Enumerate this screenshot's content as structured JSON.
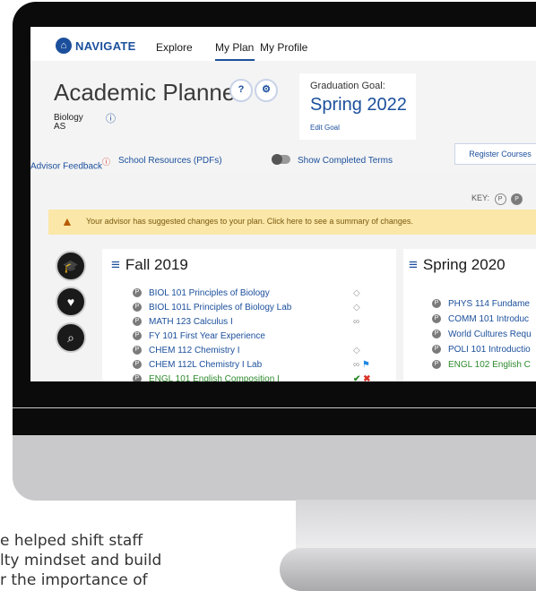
{
  "nav": {
    "logo": "NAVIGATE",
    "items": [
      "Explore",
      "My Plan",
      "My Profile"
    ]
  },
  "header": {
    "title": "Academic Planner",
    "help_icon": "question-icon",
    "settings_icon": "gear-icon",
    "major": "Biology",
    "degree": "AS",
    "graduation_goal_label": "Graduation Goal:",
    "graduation_goal_value": "Spring 2022",
    "edit_goal": "Edit Goal"
  },
  "links": {
    "advisor_feedback": "Advisor Feedback",
    "school_resources": "School Resources (PDFs)",
    "show_completed": "Show Completed Terms",
    "register": "Register Courses"
  },
  "key_label": "KEY:",
  "banner": "Your advisor has suggested changes to your plan. Click here to see a summary of changes.",
  "side_icons": [
    "graduation-cap-icon",
    "heart-icon",
    "search-icon"
  ],
  "fall": {
    "title": "Fall 2019",
    "courses": [
      "BIOL 101 Principles of Biology",
      "BIOL 101L Principles of Biology Lab",
      "MATH 123 Calculus I",
      "FY 101 First Year Experience",
      "CHEM 112 Chemistry I",
      "CHEM 112L Chemistry I Lab",
      "ENGL 101 English Composition I"
    ]
  },
  "spring": {
    "title": "Spring 2020",
    "courses": [
      "PHYS 114 Fundame",
      "COMM 101 Introduc",
      "World Cultures Requ",
      "POLI 101 Introductio",
      "ENGL 102 English C"
    ]
  },
  "caption_lines": [
    "e helped shift staff",
    "lty mindset and build",
    "r the importance of"
  ],
  "colors": {
    "brand_blue": "#1b4f9c",
    "banner_yellow": "#fbe7a8",
    "alert_red": "#d93025",
    "success_green": "#2e8a2e"
  }
}
